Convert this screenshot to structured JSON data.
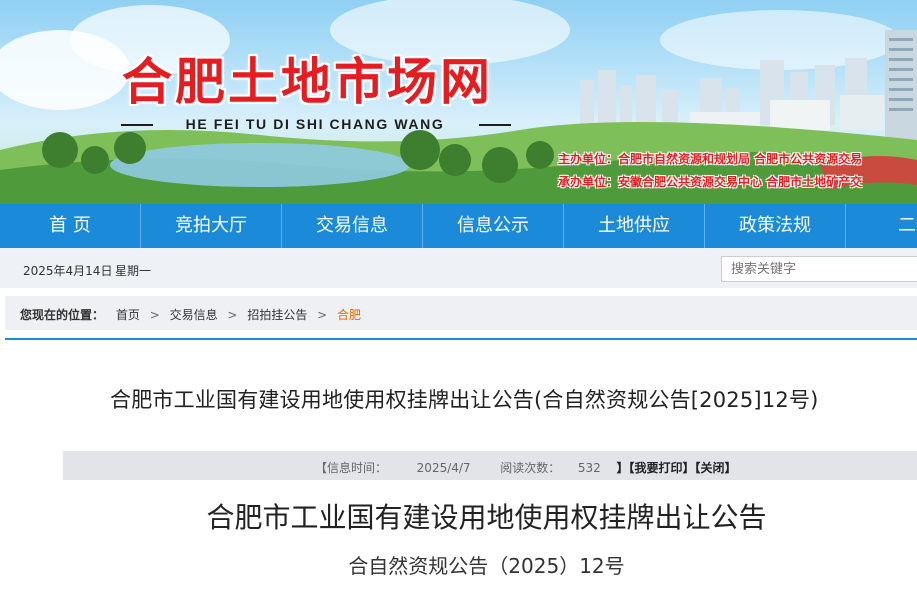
{
  "banner": {
    "site_title": "合肥土地市场网",
    "site_pinyin": "HE FEI TU DI SHI CHANG WANG",
    "host_line_1": "主办单位：合肥市自然资源和规划局  合肥市公共资源交易",
    "host_line_2": "承办单位：安徽合肥公共资源交易中心  合肥市土地矿产交"
  },
  "nav": {
    "items": [
      {
        "label": "首 页"
      },
      {
        "label": "竞拍大厅"
      },
      {
        "label": "交易信息"
      },
      {
        "label": "信息公示"
      },
      {
        "label": "土地供应"
      },
      {
        "label": "政策法规"
      },
      {
        "label": "二级"
      }
    ]
  },
  "datebar": {
    "date": "2025年4月14日",
    "weekday": "星期一",
    "search_placeholder": "搜索关键字"
  },
  "breadcrumb": {
    "label": "您现在的位置：",
    "items": [
      "首页",
      "交易信息",
      "招拍挂公告"
    ],
    "current": "合肥",
    "separator": ">"
  },
  "article": {
    "headline": "合肥市工业国有建设用地使用权挂牌出让公告(合自然资规公告[2025]12号)",
    "info": {
      "time_label": "【信息时间：",
      "time_value": "2025/4/7",
      "views_label": "阅读次数：",
      "views_value": "532",
      "bracket_close": "】",
      "print_label": "【我要打印】",
      "close_label": "【关闭】"
    },
    "doc_title": "合肥市工业国有建设用地使用权挂牌出让公告",
    "doc_number": "合自然资规公告（2025）12号"
  },
  "colors": {
    "nav_blue": "#1b8ad9",
    "title_red": "#e21e22",
    "breadcrumb_current": "#e46b00"
  }
}
